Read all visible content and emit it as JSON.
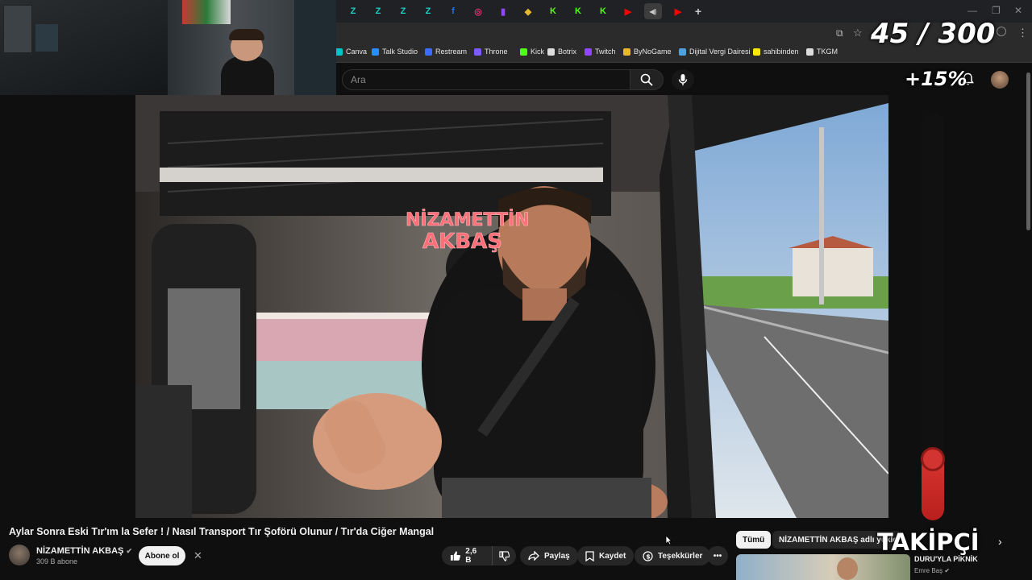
{
  "browser": {
    "tabs": [
      {
        "icon": "trovo-icon",
        "color": "#1ad0c8"
      },
      {
        "icon": "trovo-icon",
        "color": "#1ad0c8"
      },
      {
        "icon": "trovo-icon",
        "color": "#1ad0c8"
      },
      {
        "icon": "trovo-icon",
        "color": "#1ad0c8"
      },
      {
        "icon": "facebook-icon",
        "color": "#1877f2"
      },
      {
        "icon": "instagram-icon",
        "color": "#e1306c"
      },
      {
        "icon": "twitch-icon",
        "color": "#9146ff"
      },
      {
        "icon": "bynogame-icon",
        "color": "#e8b730"
      },
      {
        "icon": "kick-icon",
        "color": "#53fc18"
      },
      {
        "icon": "kick-icon",
        "color": "#53fc18"
      },
      {
        "icon": "kick-icon",
        "color": "#53fc18"
      },
      {
        "icon": "youtube-icon",
        "color": "#ff0000"
      },
      {
        "icon": "audio-icon",
        "color": "#cccccc"
      },
      {
        "icon": "youtube-icon",
        "color": "#ff0000"
      }
    ],
    "new_tab_label": "+",
    "bookmarks": [
      {
        "label": "Canva",
        "icon": "canva-icon",
        "color": "#00c4cc"
      },
      {
        "label": "Talk Studio",
        "icon": "talk-studio-icon",
        "color": "#2a8cff"
      },
      {
        "label": "Restream",
        "icon": "restream-icon",
        "color": "#3b6cff"
      },
      {
        "label": "Throne",
        "icon": "throne-icon",
        "color": "#7b5cff"
      },
      {
        "label": "Kick",
        "icon": "kick-icon",
        "color": "#53fc18"
      },
      {
        "label": "Botrix",
        "icon": "botrix-icon",
        "color": "#dddddd"
      },
      {
        "label": "Twitch",
        "icon": "twitch-icon",
        "color": "#9146ff"
      },
      {
        "label": "ByNoGame",
        "icon": "bynogame-icon",
        "color": "#e8b730"
      },
      {
        "label": "Dijital Vergi Dairesi",
        "icon": "vergi-icon",
        "color": "#4aa3df"
      },
      {
        "label": "sahibinden",
        "icon": "sahibinden-icon",
        "color": "#ffe800"
      },
      {
        "label": "TKGM",
        "icon": "location-icon",
        "color": "#dddddd"
      }
    ]
  },
  "stream_overlay": {
    "goal_counter": "45 / 300",
    "goal_percent": "+15%",
    "goal_fraction": 0.15,
    "follower_label": "TAKİPÇİ"
  },
  "youtube": {
    "search_placeholder": "Ara",
    "video_title": "Aylar Sonra Eski Tır'ım la Sefer ! / Nasıl Transport Tır Şoförü Olunur / Tır'da Ciğer Mangal",
    "channel_name": "NİZAMETTİN AKBAŞ",
    "subscribers": "309 B abone",
    "subscribe_label": "Abone ol",
    "like_count": "2,6 B",
    "share_label": "Paylaş",
    "save_label": "Kaydet",
    "thanks_label": "Teşekkürler",
    "chips": [
      "Tümü",
      "NİZAMETTİN AKBAŞ adlı yükle"
    ],
    "rec_title": "DURU'YLA PİKNİK",
    "rec_channel": "Emre Baş",
    "video_sign_line1": "NİZAMETTİN",
    "video_sign_line2": "AKBAŞ"
  }
}
